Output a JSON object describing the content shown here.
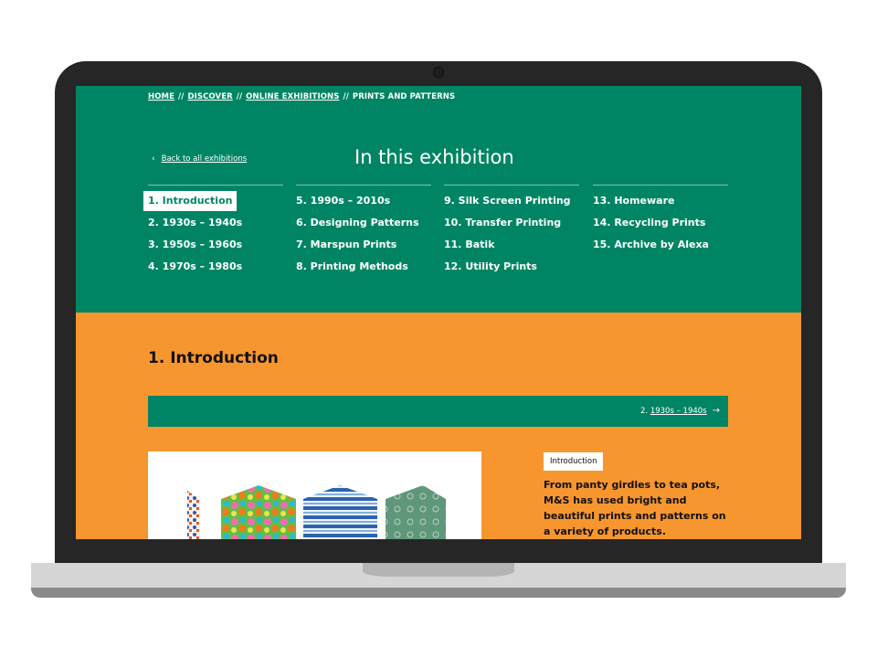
{
  "breadcrumb": {
    "items": [
      {
        "label": "HOME",
        "link": true
      },
      {
        "label": "DISCOVER",
        "link": true
      },
      {
        "label": "ONLINE EXHIBITIONS",
        "link": true
      },
      {
        "label": "PRINTS AND PATTERNS",
        "link": false
      }
    ],
    "separator": "//"
  },
  "header": {
    "back_icon": "chevron-left-icon",
    "back_label": "Back to all exhibitions",
    "title": "In this exhibition"
  },
  "nav": {
    "columns": [
      [
        "1. Introduction",
        "2. 1930s – 1940s",
        "3. 1950s – 1960s",
        "4. 1970s – 1980s"
      ],
      [
        "5. 1990s – 2010s",
        "6. Designing Patterns",
        "7. Marspun Prints",
        "8. Printing Methods"
      ],
      [
        "9. Silk Screen Printing",
        "10. Transfer Printing",
        "11. Batik",
        "12. Utility Prints"
      ],
      [
        "13. Homeware",
        "14. Recycling Prints",
        "15. Archive by Alexa"
      ]
    ],
    "active": "1. Introduction"
  },
  "content": {
    "heading": "1. Introduction",
    "next_prefix": "2.",
    "next_label": "1930s – 1940s",
    "next_icon": "arrow-right-icon",
    "tag": "Introduction",
    "body": "From panty girdles to tea pots, M&S has used bright and beautiful prints and patterns on a variety of products.",
    "image_description": "fabric swatches in hexagon shapes"
  },
  "colors": {
    "green": "#008564",
    "orange": "#f7962f",
    "bezel": "#262626"
  }
}
